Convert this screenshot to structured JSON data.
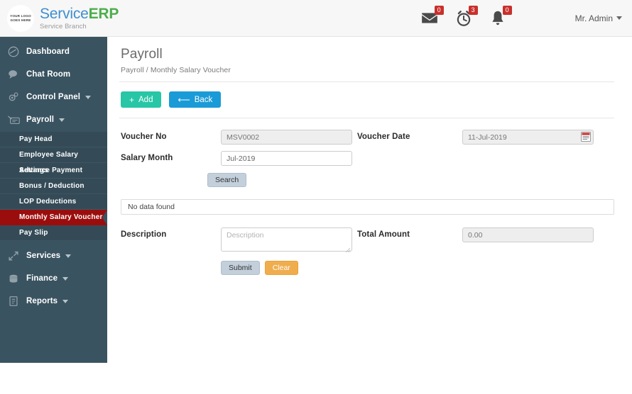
{
  "topbar": {
    "logo_line1": "YOUR LOGO",
    "logo_line2": "GOES HERE",
    "brand_first": "Service",
    "brand_second": "ERP",
    "brand_sub": "Service Branch",
    "notifications": [
      {
        "icon": "envelope-icon",
        "name": "messages",
        "count": "0"
      },
      {
        "icon": "clock-icon",
        "name": "reminders",
        "count": "3"
      },
      {
        "icon": "bell-icon",
        "name": "alerts",
        "count": "0"
      }
    ],
    "user_label": "Mr. Admin"
  },
  "sidebar": {
    "bg_color": "#3a5360",
    "active_color": "#9b0d0d",
    "items": [
      {
        "label": "Dashboard",
        "icon": "dashboard-icon",
        "caret": false
      },
      {
        "label": "Chat Room",
        "icon": "chat-icon",
        "caret": false
      },
      {
        "label": "Control Panel",
        "icon": "gears-icon",
        "caret": true
      },
      {
        "label": "Payroll",
        "icon": "payroll-icon",
        "caret": true
      }
    ],
    "submenu": [
      {
        "label": "Pay Head",
        "active": false
      },
      {
        "label": "Employee Salary Settings",
        "active": false
      },
      {
        "label": "Advance Payment",
        "active": false
      },
      {
        "label": "Bonus / Deduction",
        "active": false
      },
      {
        "label": "LOP Deductions",
        "active": false
      },
      {
        "label": "Monthly Salary Voucher",
        "active": true
      },
      {
        "label": "Pay Slip",
        "active": false
      }
    ],
    "items_after": [
      {
        "label": "Services",
        "icon": "services-icon",
        "caret": true
      },
      {
        "label": "Finance",
        "icon": "finance-icon",
        "caret": true
      },
      {
        "label": "Reports",
        "icon": "reports-icon",
        "caret": true
      }
    ]
  },
  "page": {
    "title": "Payroll",
    "breadcrumb": "Payroll / Monthly Salary Voucher",
    "add_label": "Add",
    "add_icon": "plus-icon",
    "add_color": "#27c6a6",
    "back_label": "Back",
    "back_icon": "back-arrow-icon",
    "back_color": "#1a9bd7"
  },
  "form": {
    "voucher_no_label": "Voucher No",
    "voucher_no_value": "MSV0002",
    "salary_month_label": "Salary Month",
    "salary_month_value": "Jul-2019",
    "search_label": "Search",
    "voucher_date_label": "Voucher Date",
    "voucher_date_value": "11-Jul-2019",
    "no_data_text": "No data found",
    "description_label": "Description",
    "description_value": "",
    "description_placeholder": "Description",
    "total_amount_label": "Total Amount",
    "total_amount_value": "0.00",
    "submit_label": "Submit",
    "clear_label": "Clear",
    "clear_color": "#f0ad4e"
  }
}
